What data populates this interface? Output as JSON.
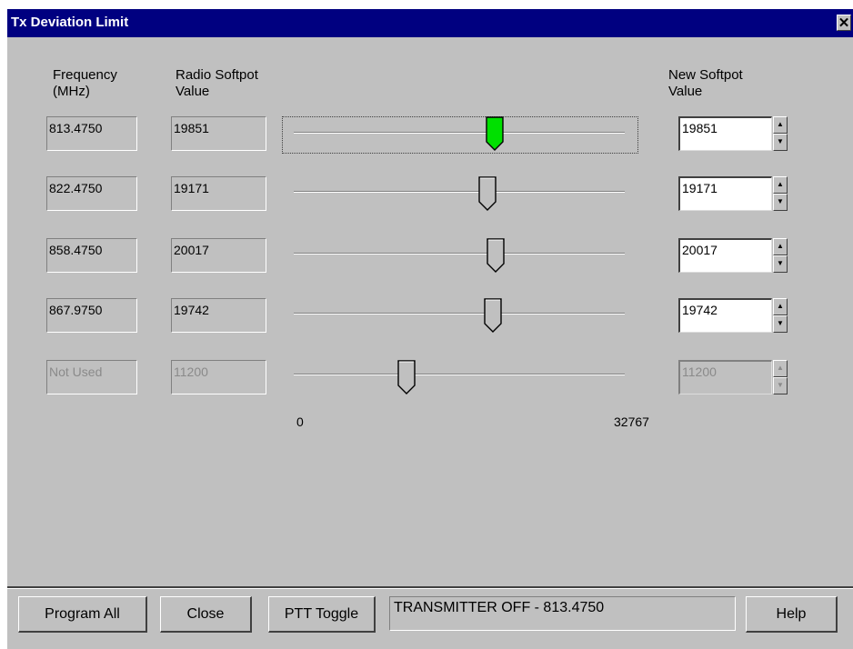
{
  "window": {
    "title": "Tx Deviation Limit",
    "close_glyph": "✕"
  },
  "headers": {
    "frequency": [
      "Frequency",
      "(MHz)"
    ],
    "radio_softpot": [
      "Radio Softpot",
      "Value"
    ],
    "new_softpot": [
      "New Softpot",
      "Value"
    ]
  },
  "rows": [
    {
      "frequency": "813.4750",
      "radio_value": "19851",
      "new_value": "19851",
      "slider_value": 19851,
      "enabled": true,
      "focused": true
    },
    {
      "frequency": "822.4750",
      "radio_value": "19171",
      "new_value": "19171",
      "slider_value": 19171,
      "enabled": true,
      "focused": false
    },
    {
      "frequency": "858.4750",
      "radio_value": "20017",
      "new_value": "20017",
      "slider_value": 20017,
      "enabled": true,
      "focused": false
    },
    {
      "frequency": "867.9750",
      "radio_value": "19742",
      "new_value": "19742",
      "slider_value": 19742,
      "enabled": true,
      "focused": false
    },
    {
      "frequency": "Not Used",
      "radio_value": "11200",
      "new_value": "11200",
      "slider_value": 11200,
      "enabled": false,
      "focused": false
    }
  ],
  "slider_scale": {
    "min": 0,
    "max": 32767,
    "min_label": "0",
    "max_label": "32767"
  },
  "spin_glyphs": {
    "up": "▲",
    "down": "▼"
  },
  "buttons": {
    "program_all": "Program All",
    "close": "Close",
    "ptt_toggle": "PTT Toggle",
    "help": "Help"
  },
  "status_text": "TRANSMITTER OFF - 813.4750",
  "colors": {
    "titlebar": "#000080",
    "face": "#c0c0c0",
    "focused_thumb": "#00e000",
    "normal_thumb": "#c0c0c0"
  }
}
